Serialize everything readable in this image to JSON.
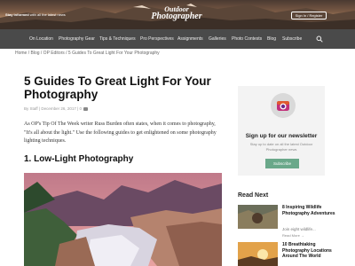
{
  "header": {
    "tagline_bold": "Stay informed",
    "tagline_rest": " with all the latest news",
    "logo_line1": "Outdoor",
    "logo_line2": "Photographer",
    "signin_label": "Sign In / Register"
  },
  "nav": {
    "items": [
      "On Location",
      "Photography Gear",
      "Tips & Techniques",
      "Pro Perspectives",
      "Assignments",
      "Galleries",
      "Photo Contests",
      "Blog",
      "Subscribe"
    ]
  },
  "breadcrumb": "Home / Blog / OP Editors / 5 Guides To Great Light For Your Photography",
  "article": {
    "title": "5 Guides To Great Light For Your Photography",
    "meta": "By Staff | December 26, 2017 | 0",
    "intro": "As OP's Tip Of The Week writer Russ Burden often states, when it comes to photography, \"It's all about the light.\" Use the following guides to get enlightened on some photography lighting techniques.",
    "section_heading": "1. Low-Light Photography"
  },
  "sidebar": {
    "newsletter_title": "Sign up for our newsletter",
    "newsletter_sub": "Stay up to date on all the latest Outdoor Photographer news",
    "subscribe_label": "Subscribe",
    "read_next_heading": "Read Next",
    "read_next": [
      {
        "title": "8 Inspiring Wildlife Photography Adventures",
        "excerpt": "Join eight wildlife...",
        "more": "Read More →"
      },
      {
        "title": "10 Breathtaking Photography Locations Around The World",
        "excerpt": "",
        "more": ""
      }
    ]
  },
  "colors": {
    "nav_bg": "#4a4a4a",
    "accent_green": "#6aa88a",
    "newsletter_bg": "#f3f3f3"
  },
  "icons": [
    "search-icon",
    "camera-icon",
    "comment-icon"
  ]
}
